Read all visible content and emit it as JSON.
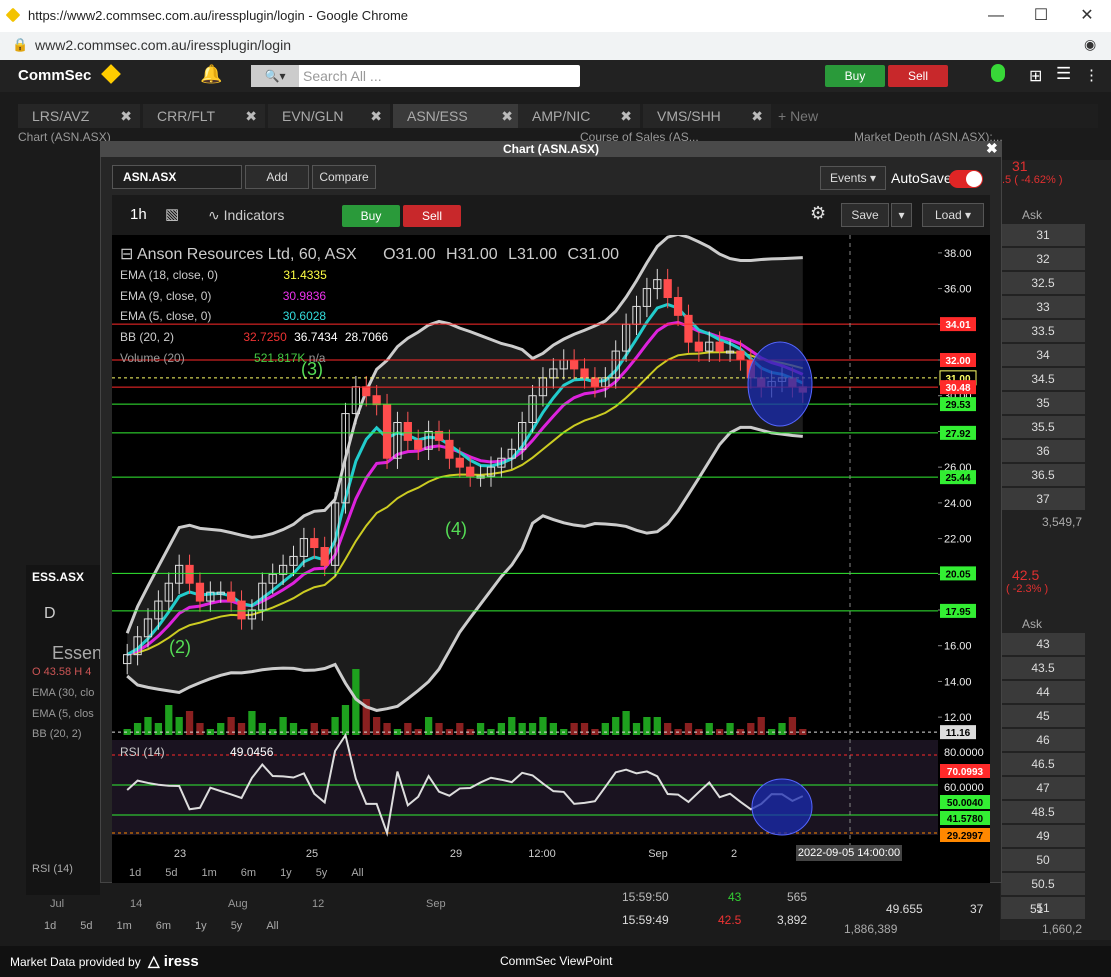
{
  "browser": {
    "title": "https://www2.commsec.com.au/iressplugin/login - Google Chrome",
    "url": "www2.commsec.com.au/iressplugin/login"
  },
  "app": {
    "logo": "CommSec",
    "search_placeholder": "Search All ...",
    "buy": "Buy",
    "sell": "Sell"
  },
  "tabs": [
    "LRS/AVZ",
    "CRR/FLT",
    "EVN/GLN",
    "ASN/ESS",
    "AMP/NIC",
    "VMS/SHH",
    "+ New"
  ],
  "panels": {
    "chart_bg": "Chart (ASN.ASX)",
    "cos": "Course of Sales (AS...",
    "depth": "Market Depth (ASN.ASX):..."
  },
  "depth": {
    "last": "31",
    "change": ".5 ( -4.62% )",
    "ask_header": "Ask",
    "asks": [
      "31",
      "32",
      "32.5",
      "33",
      "33.5",
      "34",
      "34.5",
      "35",
      "35.5",
      "36",
      "36.5",
      "37"
    ],
    "total": "3,549,7",
    "last2": "42.5",
    "change2": "( -2.3% )",
    "ask_header2": "Ask",
    "asks2": [
      "43",
      "43.5",
      "44",
      "45",
      "46",
      "46.5",
      "47",
      "48.5",
      "49",
      "50",
      "50.5",
      "51"
    ]
  },
  "bg_chart": {
    "symbol": "ESS.ASX",
    "tab": "D",
    "title": "Essent",
    "ohlc": "O 43.58  H 4",
    "ema1": "EMA (30, clo",
    "ema2": "EMA (5, clos",
    "bb": "BB (20, 2)",
    "rsi": "RSI (14)",
    "xlabels": [
      "Jul",
      "14",
      "Aug",
      "12",
      "Sep"
    ],
    "periods": [
      "1d",
      "5d",
      "1m",
      "6m",
      "1y",
      "5y",
      "All"
    ]
  },
  "cos_rows": [
    {
      "time": "15:59:50",
      "price": "43",
      "vol": "565"
    },
    {
      "time": "15:59:49",
      "price": "42.5",
      "vol": "3,892"
    }
  ],
  "depth_bottom": {
    "a": "49.655",
    "b": "37",
    "c": "51",
    "d": "1,886,389",
    "e": "1,660,2"
  },
  "dialog": {
    "title": "Chart (ASN.ASX)",
    "symbol": "ASN.ASX",
    "add": "Add",
    "compare": "Compare",
    "events": "Events",
    "autosave": "AutoSave",
    "interval": "1h",
    "indicators": "Indicators",
    "buy": "Buy",
    "sell": "Sell",
    "save": "Save",
    "load": "Load",
    "legend": {
      "title": "Anson Resources Ltd, 60, ASX",
      "o": "O31.00",
      "h": "H31.00",
      "l": "L31.00",
      "c": "C31.00",
      "ema18": "EMA (18, close, 0)",
      "ema18_v": "31.4335",
      "ema9": "EMA (9, close, 0)",
      "ema9_v": "30.9836",
      "ema5": "EMA (5, close, 0)",
      "ema5_v": "30.6028",
      "bb": "BB (20, 2)",
      "bb_v1": "32.7250",
      "bb_v2": "36.7434",
      "bb_v3": "28.7066",
      "vol": "Volume (20)",
      "vol_v": "521.817K",
      "vol_na": "n/a",
      "rsi": "RSI (14)",
      "rsi_v": "49.0456"
    },
    "periods": [
      "1d",
      "5d",
      "1m",
      "6m",
      "1y",
      "5y",
      "All"
    ],
    "crosshair_time": "2022-09-05 14:00:00"
  },
  "chart_data": {
    "type": "candlestick",
    "title": "Anson Resources Ltd, 60, ASX",
    "price_axis": [
      "38.00",
      "36.00",
      "34.00",
      "32.00",
      "30.00",
      "28.00",
      "26.00",
      "24.00",
      "22.00",
      "20.00",
      "18.00",
      "16.00",
      "14.00",
      "12.00"
    ],
    "ylim": [
      11,
      39
    ],
    "x_ticks": [
      "23",
      "25",
      "29",
      "12:00",
      "Sep",
      "2"
    ],
    "price_tags": [
      {
        "value": "34.01",
        "color": "#ff2a2a"
      },
      {
        "value": "32.00",
        "color": "#ff2a2a"
      },
      {
        "value": "31.00",
        "color": "#ffff66"
      },
      {
        "value": "30.48",
        "color": "#ff2a2a"
      },
      {
        "value": "29.53",
        "color": "#33ee33"
      },
      {
        "value": "27.92",
        "color": "#33ee33"
      },
      {
        "value": "25.44",
        "color": "#33ee33"
      },
      {
        "value": "20.05",
        "color": "#33ee33"
      },
      {
        "value": "17.95",
        "color": "#33ee33"
      },
      {
        "value": "11.16",
        "color": "#dddddd"
      }
    ],
    "wave_labels": [
      "(2)",
      "(3)",
      "(4)"
    ],
    "rsi_axis": [
      "80.0000",
      "60.0000"
    ],
    "rsi_tags": [
      {
        "value": "70.0993",
        "color": "#ff2a2a"
      },
      {
        "value": "50.0040",
        "color": "#33ee33"
      },
      {
        "value": "41.5780",
        "color": "#33ee33"
      },
      {
        "value": "29.2997",
        "color": "#ff8800"
      }
    ],
    "closes": [
      15.5,
      16.5,
      17.5,
      18.5,
      19.5,
      20.5,
      19.5,
      18.5,
      19,
      19,
      18.5,
      17.5,
      18,
      19.5,
      20,
      20.5,
      21,
      22,
      21.5,
      20.5,
      24,
      29,
      30.5,
      30,
      29.5,
      26.5,
      28.5,
      27.5,
      27,
      28,
      27.5,
      26.5,
      26,
      25.5,
      25.5,
      26,
      26.5,
      27,
      28.5,
      30,
      31,
      31.5,
      32,
      31.5,
      31,
      30.5,
      31,
      32.5,
      34,
      35,
      36,
      36.5,
      35.5,
      34.5,
      33,
      32.5,
      33,
      32.5,
      32.5,
      32,
      31,
      30.5,
      30.8,
      31,
      30.5,
      30.2
    ],
    "volume": [
      1,
      2,
      3,
      2,
      5,
      3,
      4,
      2,
      1,
      2,
      3,
      2,
      4,
      2,
      1,
      3,
      2,
      1,
      2,
      1,
      3,
      5,
      11,
      6,
      3,
      2,
      1,
      2,
      1,
      3,
      2,
      1,
      2,
      1,
      2,
      1,
      2,
      3,
      2,
      2,
      3,
      2,
      1,
      2,
      2,
      1,
      2,
      3,
      4,
      2,
      3,
      3,
      2,
      1,
      2,
      1,
      2,
      1,
      2,
      1,
      2,
      3,
      1,
      2,
      3,
      1
    ]
  }
}
